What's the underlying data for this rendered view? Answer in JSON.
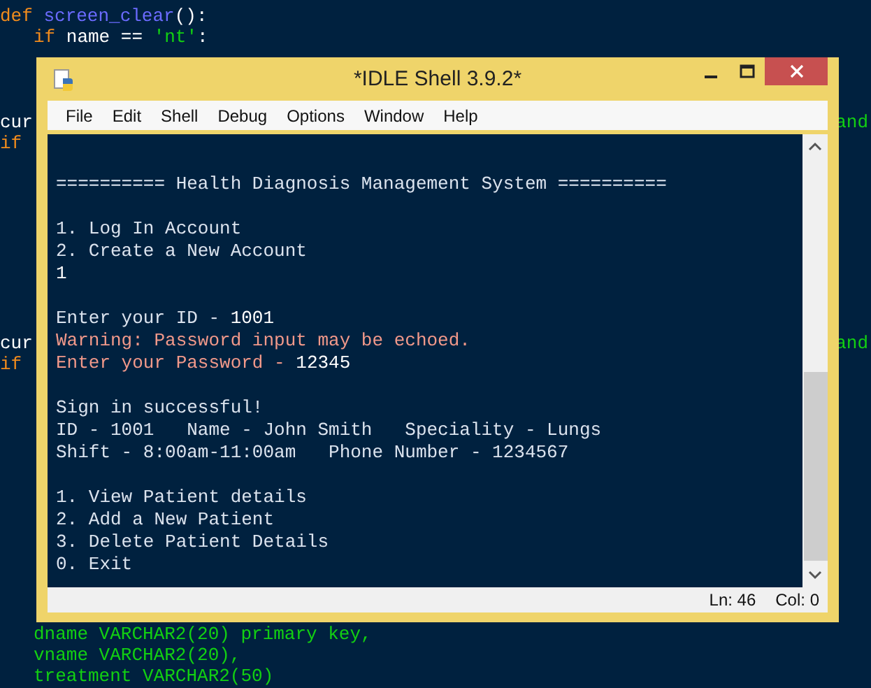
{
  "editor": {
    "sections": [
      {
        "lines": [
          {
            "indent": false,
            "left": [
              {
                "kind": "keyword",
                "text": "def "
              },
              {
                "kind": "name",
                "text": "screen_clear"
              },
              {
                "kind": "plain",
                "text": "():"
              }
            ]
          },
          {
            "indent": true,
            "left": [
              {
                "kind": "keyword",
                "text": "if "
              },
              {
                "kind": "plain",
                "text": "name == "
              },
              {
                "kind": "string",
                "text": "'nt'"
              },
              {
                "kind": "plain",
                "text": ":"
              }
            ]
          }
        ]
      },
      {
        "lines": [
          {
            "indent": false,
            "left": [
              {
                "kind": "plain",
                "text": "cur"
              }
            ],
            "right": [
              {
                "kind": "string",
                "text": "and"
              }
            ]
          },
          {
            "indent": false,
            "left": [
              {
                "kind": "keyword",
                "text": "if"
              }
            ]
          }
        ]
      },
      {
        "lines": [
          {
            "indent": false,
            "left": [
              {
                "kind": "plain",
                "text": "cur"
              }
            ],
            "right": [
              {
                "kind": "string",
                "text": "and"
              }
            ]
          },
          {
            "indent": false,
            "left": [
              {
                "kind": "keyword",
                "text": "if"
              }
            ]
          }
        ]
      },
      {
        "lines": [
          {
            "indent": true,
            "left": [
              {
                "kind": "string",
                "text": "dname VARCHAR2(20) primary key,"
              }
            ]
          },
          {
            "indent": true,
            "left": [
              {
                "kind": "string",
                "text": "vname VARCHAR2(20),"
              }
            ]
          },
          {
            "indent": true,
            "left": [
              {
                "kind": "string",
                "text": "treatment VARCHAR2(50)"
              }
            ]
          }
        ]
      }
    ]
  },
  "window": {
    "title": "*IDLE Shell 3.9.2*",
    "menu": [
      "File",
      "Edit",
      "Shell",
      "Debug",
      "Options",
      "Window",
      "Help"
    ],
    "shell": {
      "blocks": [
        [
          [
            {
              "kind": "stdout",
              "text": "========== Health Diagnosis Management System =========="
            }
          ]
        ],
        [
          [
            {
              "kind": "stdout",
              "text": "1. Log In Account"
            }
          ],
          [
            {
              "kind": "stdout",
              "text": "2. Create a New Account"
            }
          ],
          [
            {
              "kind": "stdin",
              "text": "1"
            }
          ]
        ],
        [
          [
            {
              "kind": "stdout",
              "text": "Enter your ID - "
            },
            {
              "kind": "stdin",
              "text": "1001"
            }
          ],
          [
            {
              "kind": "stderr",
              "text": "Warning: Password input may be echoed."
            }
          ],
          [
            {
              "kind": "stderr",
              "text": "Enter your Password - "
            },
            {
              "kind": "stdin",
              "text": "12345"
            }
          ]
        ],
        [
          [
            {
              "kind": "stdout",
              "text": "Sign in successful!"
            }
          ],
          [
            {
              "kind": "stdout",
              "text": "ID - 1001   Name - John Smith   Speciality - Lungs"
            }
          ],
          [
            {
              "kind": "stdout",
              "text": "Shift - 8:00am-11:00am   Phone Number - 1234567"
            }
          ]
        ],
        [
          [
            {
              "kind": "stdout",
              "text": "1. View Patient details"
            }
          ],
          [
            {
              "kind": "stdout",
              "text": "2. Add a New Patient"
            }
          ],
          [
            {
              "kind": "stdout",
              "text": "3. Delete Patient Details"
            }
          ],
          [
            {
              "kind": "stdout",
              "text": "0. Exit"
            }
          ]
        ]
      ]
    },
    "status_bar": {
      "line": "Ln: 46",
      "column": "Col: 0"
    }
  }
}
